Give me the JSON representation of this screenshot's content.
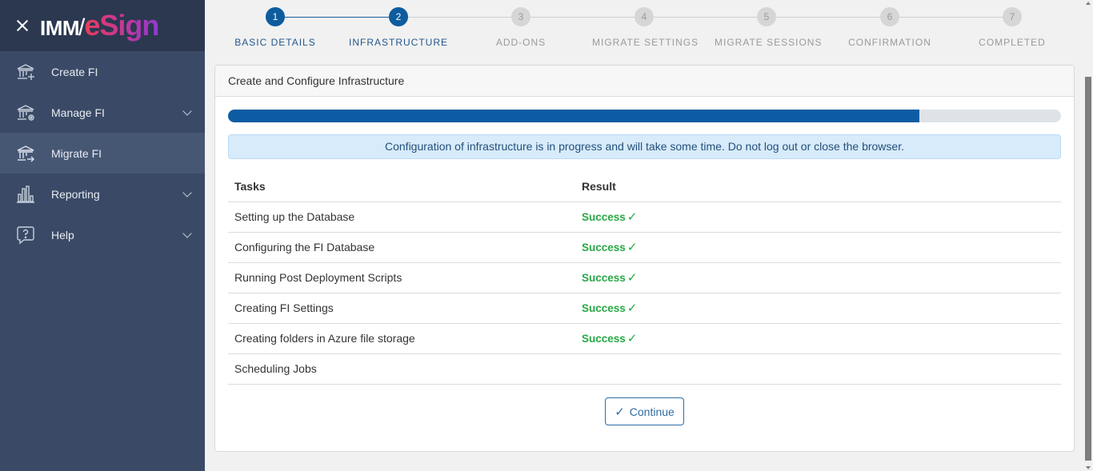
{
  "brand": {
    "part1": "IMM",
    "slash": "/",
    "part2": "eSign"
  },
  "sidebar": {
    "items": [
      {
        "label": "Create FI",
        "icon": "bank-plus-icon",
        "expandable": false,
        "active": false
      },
      {
        "label": "Manage FI",
        "icon": "bank-gear-icon",
        "expandable": true,
        "active": false
      },
      {
        "label": "Migrate FI",
        "icon": "bank-arrow-icon",
        "expandable": false,
        "active": true
      },
      {
        "label": "Reporting",
        "icon": "bar-chart-icon",
        "expandable": true,
        "active": false
      },
      {
        "label": "Help",
        "icon": "help-bubble-icon",
        "expandable": true,
        "active": false
      }
    ]
  },
  "stepper": {
    "current_step": 2,
    "steps": [
      {
        "number": "1",
        "label": "BASIC DETAILS"
      },
      {
        "number": "2",
        "label": "INFRASTRUCTURE"
      },
      {
        "number": "3",
        "label": "ADD-ONS"
      },
      {
        "number": "4",
        "label": "MIGRATE SETTINGS"
      },
      {
        "number": "5",
        "label": "MIGRATE SESSIONS"
      },
      {
        "number": "6",
        "label": "CONFIRMATION"
      },
      {
        "number": "7",
        "label": "COMPLETED"
      }
    ]
  },
  "card": {
    "title": "Create and Configure Infrastructure",
    "progress_percent": 83,
    "alert": "Configuration of infrastructure is in progress and will take some time. Do not log out or close the browser.",
    "table": {
      "headers": [
        "Tasks",
        "Result"
      ],
      "rows": [
        {
          "task": "Setting up the Database",
          "result": "Success",
          "check": "✓"
        },
        {
          "task": "Configuring the FI Database",
          "result": "Success",
          "check": "✓"
        },
        {
          "task": "Running Post Deployment Scripts",
          "result": "Success",
          "check": "✓"
        },
        {
          "task": "Creating FI Settings",
          "result": "Success",
          "check": "✓"
        },
        {
          "task": "Creating folders in Azure file storage",
          "result": "Success",
          "check": "✓"
        },
        {
          "task": "Scheduling Jobs",
          "result": "",
          "check": ""
        }
      ]
    },
    "continue_label": "Continue",
    "continue_icon": "✓"
  },
  "colors": {
    "sidebar_bg": "#3a4a66",
    "sidebar_header_bg": "#2b3850",
    "accent": "#0d5c9e",
    "success": "#27a845",
    "alert_bg": "#d7ebfb"
  }
}
